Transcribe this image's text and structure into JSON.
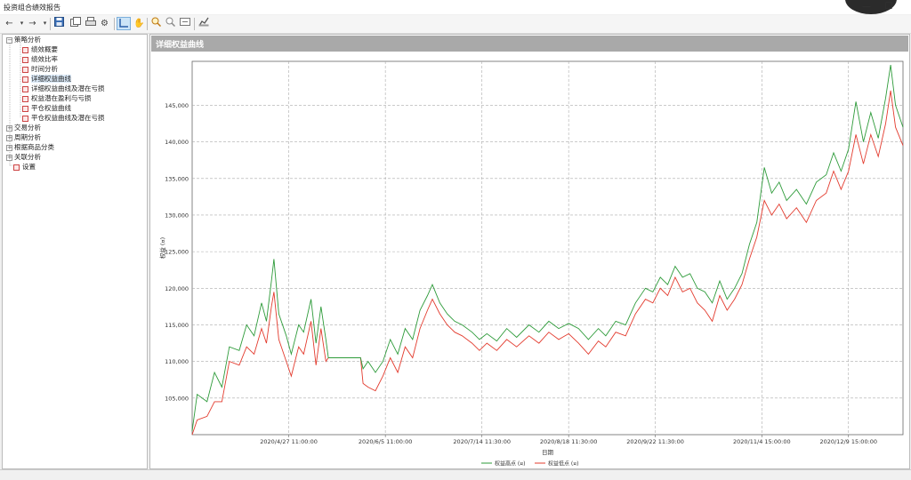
{
  "window": {
    "title": "投资组合绩效报告",
    "minimize": "—",
    "maximize": "☐"
  },
  "toolbar": {
    "icons": [
      "back-icon",
      "forward-icon",
      "dropdown-icon",
      "save-icon",
      "copy-icon",
      "print-icon",
      "settings-icon",
      "crosshair-icon",
      "hand-pan-icon",
      "zoom-in-icon",
      "zoom-out-icon",
      "fit-icon",
      "export-icon"
    ]
  },
  "tree": {
    "groups": [
      {
        "label": "策略分析",
        "expanded": true,
        "items": [
          "绩效概要",
          "绩效比率",
          "时间分析",
          "详细权益曲线",
          "详细权益曲线及潜在亏损",
          "权益潜在盈利与亏损",
          "平仓权益曲线",
          "平仓权益曲线及潜在亏损"
        ]
      },
      {
        "label": "交易分析",
        "expanded": false
      },
      {
        "label": "周期分析",
        "expanded": false
      },
      {
        "label": "根据商品分类",
        "expanded": false
      },
      {
        "label": "关联分析",
        "expanded": false
      }
    ],
    "extra": "设置",
    "selected": "详细权益曲线"
  },
  "main": {
    "header": "详细权益曲线"
  },
  "chart_data": {
    "type": "line",
    "xlabel": "日期",
    "ylabel": "权益 (¤)",
    "ylim": [
      100000,
      151000
    ],
    "yticks": [
      105000,
      110000,
      115000,
      120000,
      125000,
      130000,
      135000,
      140000,
      145000
    ],
    "ytick_labels": [
      "105,000",
      "110,000",
      "115,000",
      "120,000",
      "125,000",
      "130,000",
      "135,000",
      "140,000",
      "145,000"
    ],
    "xrange": [
      "2020-03-19",
      "2020-12-31"
    ],
    "xticks": [
      "2020-04-27",
      "2020-06-05",
      "2020-07-14",
      "2020-08-18",
      "2020-09-22",
      "2020-11-04",
      "2020-12-09"
    ],
    "xtick_labels": [
      "2020/4/27 11:00:00",
      "2020/6/5 11:00:00",
      "2020/7/14 11:30:00",
      "2020/8/18 11:30:00",
      "2020/9/22 11:30:00",
      "2020/11/4 15:00:00",
      "2020/12/9 15:00:00"
    ],
    "grid": true,
    "legend_position": "bottom-center",
    "series": [
      {
        "name": "权益高点 (¤)",
        "color": "#2e9b3a",
        "points": [
          [
            "2020-03-19",
            100500
          ],
          [
            "2020-03-21",
            105500
          ],
          [
            "2020-03-25",
            104500
          ],
          [
            "2020-03-28",
            108500
          ],
          [
            "2020-03-31",
            106500
          ],
          [
            "2020-04-03",
            112000
          ],
          [
            "2020-04-07",
            111500
          ],
          [
            "2020-04-10",
            115000
          ],
          [
            "2020-04-13",
            113500
          ],
          [
            "2020-04-16",
            118000
          ],
          [
            "2020-04-18",
            115500
          ],
          [
            "2020-04-20",
            121000
          ],
          [
            "2020-04-21",
            124000
          ],
          [
            "2020-04-23",
            116500
          ],
          [
            "2020-04-26",
            113500
          ],
          [
            "2020-04-28",
            111000
          ],
          [
            "2020-05-01",
            115000
          ],
          [
            "2020-05-03",
            114000
          ],
          [
            "2020-05-06",
            118500
          ],
          [
            "2020-05-08",
            112500
          ],
          [
            "2020-05-10",
            117500
          ],
          [
            "2020-05-12",
            113000
          ],
          [
            "2020-05-13",
            110500
          ],
          [
            "2020-05-16",
            110500
          ],
          [
            "2020-05-20",
            110500
          ],
          [
            "2020-05-23",
            110500
          ],
          [
            "2020-05-26",
            110500
          ],
          [
            "2020-05-27",
            109000
          ],
          [
            "2020-05-29",
            110000
          ],
          [
            "2020-06-01",
            108500
          ],
          [
            "2020-06-04",
            110000
          ],
          [
            "2020-06-07",
            113000
          ],
          [
            "2020-06-10",
            111000
          ],
          [
            "2020-06-13",
            114500
          ],
          [
            "2020-06-16",
            113000
          ],
          [
            "2020-06-19",
            117000
          ],
          [
            "2020-06-22",
            119000
          ],
          [
            "2020-06-24",
            120500
          ],
          [
            "2020-06-27",
            118000
          ],
          [
            "2020-06-30",
            116500
          ],
          [
            "2020-07-03",
            115500
          ],
          [
            "2020-07-06",
            115000
          ],
          [
            "2020-07-10",
            114000
          ],
          [
            "2020-07-13",
            113000
          ],
          [
            "2020-07-16",
            113800
          ],
          [
            "2020-07-20",
            112800
          ],
          [
            "2020-07-24",
            114500
          ],
          [
            "2020-07-28",
            113300
          ],
          [
            "2020-08-02",
            115000
          ],
          [
            "2020-08-06",
            114000
          ],
          [
            "2020-08-10",
            115500
          ],
          [
            "2020-08-14",
            114500
          ],
          [
            "2020-08-18",
            115200
          ],
          [
            "2020-08-22",
            114500
          ],
          [
            "2020-08-26",
            113000
          ],
          [
            "2020-08-30",
            114500
          ],
          [
            "2020-09-02",
            113500
          ],
          [
            "2020-09-06",
            115500
          ],
          [
            "2020-09-10",
            115000
          ],
          [
            "2020-09-14",
            118000
          ],
          [
            "2020-09-18",
            120000
          ],
          [
            "2020-09-21",
            119500
          ],
          [
            "2020-09-24",
            121500
          ],
          [
            "2020-09-27",
            120500
          ],
          [
            "2020-09-30",
            123000
          ],
          [
            "2020-10-03",
            121500
          ],
          [
            "2020-10-06",
            122000
          ],
          [
            "2020-10-09",
            120000
          ],
          [
            "2020-10-12",
            119500
          ],
          [
            "2020-10-15",
            118000
          ],
          [
            "2020-10-18",
            121000
          ],
          [
            "2020-10-21",
            118500
          ],
          [
            "2020-10-24",
            120000
          ],
          [
            "2020-10-27",
            122000
          ],
          [
            "2020-10-30",
            126000
          ],
          [
            "2020-11-02",
            129000
          ],
          [
            "2020-11-05",
            136500
          ],
          [
            "2020-11-08",
            133000
          ],
          [
            "2020-11-11",
            134500
          ],
          [
            "2020-11-14",
            132000
          ],
          [
            "2020-11-18",
            133500
          ],
          [
            "2020-11-22",
            131500
          ],
          [
            "2020-11-26",
            134500
          ],
          [
            "2020-11-30",
            135500
          ],
          [
            "2020-12-03",
            138500
          ],
          [
            "2020-12-06",
            136000
          ],
          [
            "2020-12-09",
            139000
          ],
          [
            "2020-12-12",
            145500
          ],
          [
            "2020-12-15",
            140000
          ],
          [
            "2020-12-18",
            144000
          ],
          [
            "2020-12-21",
            140500
          ],
          [
            "2020-12-24",
            146000
          ],
          [
            "2020-12-26",
            150500
          ],
          [
            "2020-12-28",
            145000
          ],
          [
            "2020-12-31",
            142000
          ]
        ]
      },
      {
        "name": "权益低点 (¤)",
        "color": "#e33b2e",
        "points": [
          [
            "2020-03-19",
            100000
          ],
          [
            "2020-03-21",
            102000
          ],
          [
            "2020-03-25",
            102500
          ],
          [
            "2020-03-28",
            104500
          ],
          [
            "2020-03-31",
            104500
          ],
          [
            "2020-04-03",
            110000
          ],
          [
            "2020-04-07",
            109500
          ],
          [
            "2020-04-10",
            112000
          ],
          [
            "2020-04-13",
            111000
          ],
          [
            "2020-04-16",
            114500
          ],
          [
            "2020-04-18",
            112500
          ],
          [
            "2020-04-20",
            117500
          ],
          [
            "2020-04-21",
            119500
          ],
          [
            "2020-04-23",
            113000
          ],
          [
            "2020-04-26",
            110000
          ],
          [
            "2020-04-28",
            108000
          ],
          [
            "2020-05-01",
            112000
          ],
          [
            "2020-05-03",
            111000
          ],
          [
            "2020-05-06",
            115500
          ],
          [
            "2020-05-08",
            109500
          ],
          [
            "2020-05-10",
            114500
          ],
          [
            "2020-05-12",
            110000
          ],
          [
            "2020-05-13",
            110500
          ],
          [
            "2020-05-16",
            110500
          ],
          [
            "2020-05-20",
            110500
          ],
          [
            "2020-05-23",
            110500
          ],
          [
            "2020-05-26",
            110500
          ],
          [
            "2020-05-27",
            107000
          ],
          [
            "2020-05-29",
            106500
          ],
          [
            "2020-06-01",
            106000
          ],
          [
            "2020-06-04",
            108000
          ],
          [
            "2020-06-07",
            110500
          ],
          [
            "2020-06-10",
            108500
          ],
          [
            "2020-06-13",
            112000
          ],
          [
            "2020-06-16",
            110500
          ],
          [
            "2020-06-19",
            114500
          ],
          [
            "2020-06-22",
            117000
          ],
          [
            "2020-06-24",
            118500
          ],
          [
            "2020-06-27",
            116500
          ],
          [
            "2020-06-30",
            115000
          ],
          [
            "2020-07-03",
            114000
          ],
          [
            "2020-07-06",
            113500
          ],
          [
            "2020-07-10",
            112500
          ],
          [
            "2020-07-13",
            111500
          ],
          [
            "2020-07-16",
            112500
          ],
          [
            "2020-07-20",
            111500
          ],
          [
            "2020-07-24",
            113000
          ],
          [
            "2020-07-28",
            112000
          ],
          [
            "2020-08-02",
            113500
          ],
          [
            "2020-08-06",
            112500
          ],
          [
            "2020-08-10",
            114000
          ],
          [
            "2020-08-14",
            113000
          ],
          [
            "2020-08-18",
            113800
          ],
          [
            "2020-08-22",
            112500
          ],
          [
            "2020-08-26",
            111000
          ],
          [
            "2020-08-30",
            112800
          ],
          [
            "2020-09-02",
            112000
          ],
          [
            "2020-09-06",
            114000
          ],
          [
            "2020-09-10",
            113500
          ],
          [
            "2020-09-14",
            116500
          ],
          [
            "2020-09-18",
            118500
          ],
          [
            "2020-09-21",
            118000
          ],
          [
            "2020-09-24",
            120000
          ],
          [
            "2020-09-27",
            119000
          ],
          [
            "2020-09-30",
            121500
          ],
          [
            "2020-10-03",
            119500
          ],
          [
            "2020-10-06",
            120000
          ],
          [
            "2020-10-09",
            118000
          ],
          [
            "2020-10-12",
            117000
          ],
          [
            "2020-10-15",
            115500
          ],
          [
            "2020-10-18",
            119000
          ],
          [
            "2020-10-21",
            117000
          ],
          [
            "2020-10-24",
            118500
          ],
          [
            "2020-10-27",
            120500
          ],
          [
            "2020-10-30",
            124000
          ],
          [
            "2020-11-02",
            127000
          ],
          [
            "2020-11-05",
            132000
          ],
          [
            "2020-11-08",
            130000
          ],
          [
            "2020-11-11",
            131500
          ],
          [
            "2020-11-14",
            129500
          ],
          [
            "2020-11-18",
            131000
          ],
          [
            "2020-11-22",
            129000
          ],
          [
            "2020-11-26",
            132000
          ],
          [
            "2020-11-30",
            133000
          ],
          [
            "2020-12-03",
            136000
          ],
          [
            "2020-12-06",
            133500
          ],
          [
            "2020-12-09",
            136000
          ],
          [
            "2020-12-12",
            141000
          ],
          [
            "2020-12-15",
            137000
          ],
          [
            "2020-12-18",
            141000
          ],
          [
            "2020-12-21",
            138000
          ],
          [
            "2020-12-24",
            142500
          ],
          [
            "2020-12-26",
            147000
          ],
          [
            "2020-12-28",
            142000
          ],
          [
            "2020-12-31",
            139500
          ]
        ]
      }
    ]
  }
}
